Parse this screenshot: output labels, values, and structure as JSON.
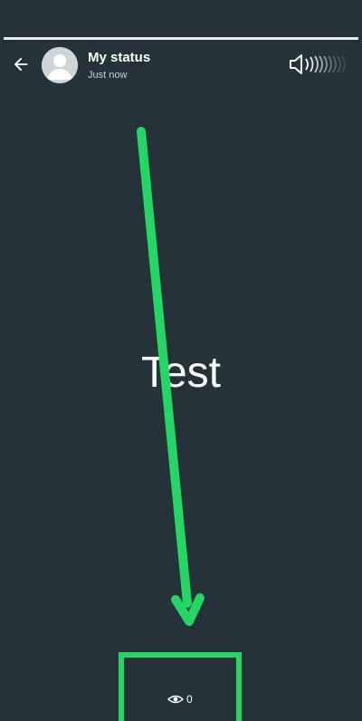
{
  "status_viewer": {
    "progress": 1.0,
    "header": {
      "title": "My status",
      "timestamp": "Just now",
      "back_icon": "arrow-left-icon",
      "avatar_icon": "default-avatar-icon",
      "mute_icon": "volume-speaker-icon"
    },
    "content": {
      "text": "Test"
    },
    "footer": {
      "views_icon": "eye-icon",
      "views_count": "0"
    }
  },
  "colors": {
    "background": "#25323a",
    "text": "#ffffff",
    "annotation": "#22d764"
  }
}
